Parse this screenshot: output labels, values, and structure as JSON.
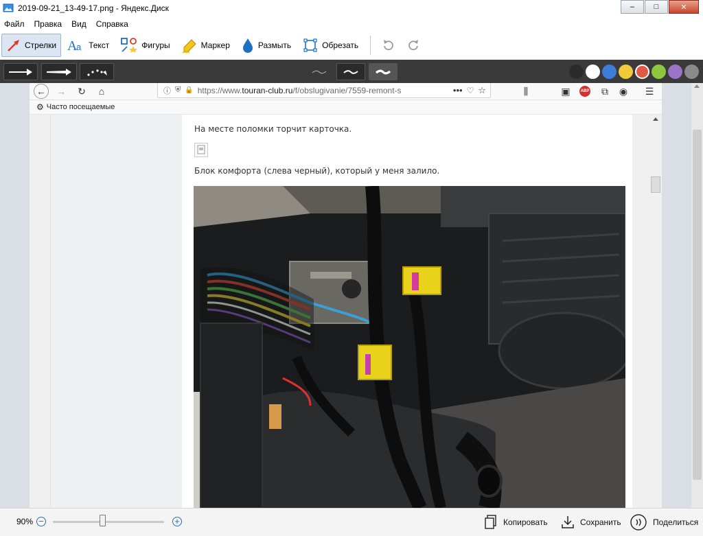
{
  "window": {
    "title": "2019-09-21_13-49-17.png - Яндекс.Диск",
    "min": "–",
    "max": "□",
    "close": "✕"
  },
  "menu": [
    "Файл",
    "Правка",
    "Вид",
    "Справка"
  ],
  "toolbar": {
    "tools": [
      {
        "label": "Стрелки",
        "icon": "arrow-icon"
      },
      {
        "label": "Текст",
        "icon": "text-icon"
      },
      {
        "label": "Фигуры",
        "icon": "shapes-icon"
      },
      {
        "label": "Маркер",
        "icon": "marker-icon"
      },
      {
        "label": "Размыть",
        "icon": "blur-icon"
      },
      {
        "label": "Обрезать",
        "icon": "crop-icon"
      }
    ]
  },
  "palette": [
    "#2b2b2b",
    "#ffffff",
    "#3b7dd8",
    "#f2c93b",
    "#e05a47",
    "#8dc63f",
    "#9b73c9",
    "#8a8a8a"
  ],
  "browser": {
    "url_prefix": "https://www.",
    "url_domain": "touran-club.ru",
    "url_rest": "/f/obslugivanie/7559-remont-s",
    "bookmarks_label": "Часто посещаемые",
    "abp_badge": "ABP"
  },
  "article": {
    "line1": "На месте поломки торчит карточка.",
    "line2": "Блок комфорта (слева черный), который у меня залило."
  },
  "status": {
    "zoom": "90%",
    "zoom_minus": "−",
    "zoom_plus": "+",
    "copy": "Копировать",
    "save": "Сохранить",
    "share": "Поделиться"
  }
}
